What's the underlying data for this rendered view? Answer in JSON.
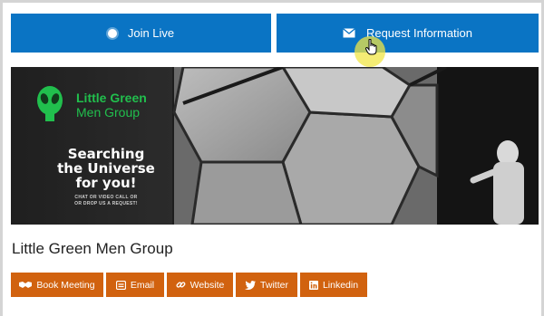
{
  "actions": {
    "join_label": "Join Live",
    "request_label": "Request Information"
  },
  "banner": {
    "brand_line1": "Little Green",
    "brand_line2": "Men Group",
    "headline_1": "Searching",
    "headline_2": "the Universe",
    "headline_3": "for you!",
    "tagline_1": "CHAT OR VIDEO CALL OR",
    "tagline_2": "OR DROP US A REQUEST!"
  },
  "profile": {
    "name": "Little Green Men Group"
  },
  "social": {
    "book": "Book Meeting",
    "email": "Email",
    "website": "Website",
    "twitter": "Twitter",
    "linkedin": "Linkedin"
  },
  "colors": {
    "primary_blue": "#0a74c4",
    "accent_orange": "#d1620f",
    "brand_green": "#21bf4d"
  },
  "icons": {
    "join": "radio-dot-icon",
    "request": "envelope-icon",
    "book": "handshake-icon",
    "email": "email-icon",
    "website": "link-icon",
    "twitter": "twitter-bird-icon",
    "linkedin": "linkedin-icon"
  }
}
